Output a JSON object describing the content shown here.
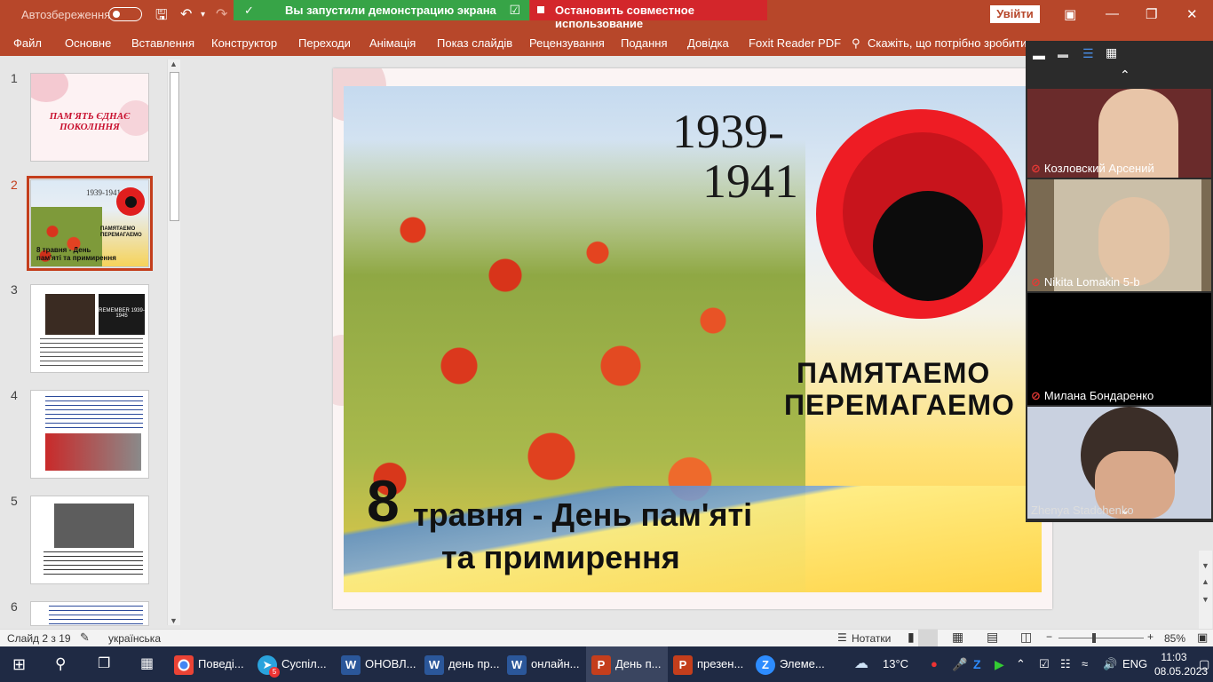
{
  "titlebar": {
    "autosave_label": "Автозбереження",
    "share_status": "Вы запустили демонстрацию экрана",
    "stop_share": "Остановить совместное использование",
    "signin": "Увійти"
  },
  "ribbon": {
    "tabs": [
      "Файл",
      "Основне",
      "Вставлення",
      "Конструктор",
      "Переходи",
      "Анімація",
      "Показ слайдів",
      "Рецензування",
      "Подання",
      "Довідка",
      "Foxit Reader PDF"
    ],
    "tell_me": "Скажіть, що потрібно зробити"
  },
  "thumbnails": [
    {
      "num": "1",
      "title": "ПАМ'ЯТЬ ЄДНАЄ ПОКОЛІННЯ"
    },
    {
      "num": "2",
      "years": "1939-1941",
      "motto": "ПАМЯТАЕМО ПЕРЕМАГАЕМО",
      "caption": "8 травня - День пам'яті та примирення"
    },
    {
      "num": "3",
      "photo_text": "REMEMBER 1939-1945"
    },
    {
      "num": "4"
    },
    {
      "num": "5"
    },
    {
      "num": "6"
    }
  ],
  "slide": {
    "year_start": "1939-",
    "year_end": "1941",
    "motto_line1": "ПАМЯТАЕМО",
    "motto_line2": "ПЕРЕМАГАЕМО",
    "day_number": "8",
    "caption_line1": "травня - День пам'яті",
    "caption_line2": "та примирення"
  },
  "meeting": {
    "participants": [
      {
        "name": "Козловский Арсений"
      },
      {
        "name": "Nikita Lomakin 5-b"
      },
      {
        "name": "Милана Бондаренко"
      },
      {
        "name": "Zhenya Stadchenko"
      }
    ]
  },
  "status": {
    "slide_info": "Слайд 2 з 19",
    "language": "українська",
    "notes": "Нотатки",
    "zoom": "85%"
  },
  "taskbar": {
    "items": [
      {
        "label": "Поведі...",
        "icon": "chrome-icon"
      },
      {
        "label": "Суспіл...",
        "icon": "telegram-icon"
      },
      {
        "label": "ОНОВЛ...",
        "icon": "word-icon"
      },
      {
        "label": "день пр...",
        "icon": "word-icon"
      },
      {
        "label": "онлайн...",
        "icon": "word-icon"
      },
      {
        "label": "День п...",
        "icon": "powerpoint-icon"
      },
      {
        "label": "презен...",
        "icon": "powerpoint-icon"
      },
      {
        "label": "Элеме...",
        "icon": "zoom-icon"
      }
    ],
    "telegram_badge": "5",
    "weather": "13°C",
    "lang": "ENG",
    "time": "11:03",
    "date": "08.05.2023"
  },
  "colors": {
    "accent": "#b7472a",
    "share_green": "#37a447",
    "share_red": "#d3262b",
    "taskbar": "#1f2a44"
  }
}
